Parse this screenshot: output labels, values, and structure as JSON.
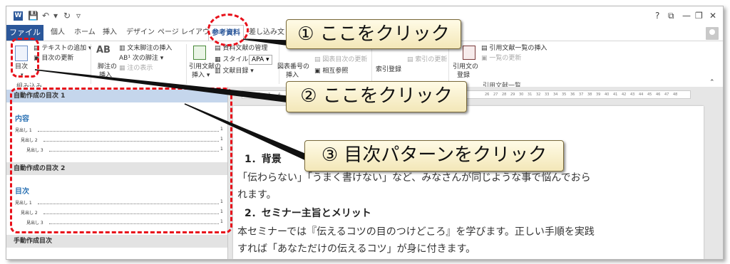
{
  "titlebar": {
    "app_icon": "W",
    "save_icon": "save-icon",
    "undo_icon": "undo-icon",
    "redo_icon": "redo-icon",
    "help": "?",
    "window_icons": [
      "restore-ribbon-icon",
      "minimize-icon",
      "maximize-icon",
      "close-icon"
    ]
  },
  "tabs": {
    "file": "ファイル",
    "items": [
      "個人",
      "ホーム",
      "挿入",
      "デザイン",
      "ページ レイアウト",
      "参考資料",
      "差し込み文"
    ]
  },
  "ribbon": {
    "toc": {
      "label": "目次",
      "add_text": "テキストの追加",
      "update": "目次の更新"
    },
    "footnote": {
      "label": "脚注の\n挿入",
      "endnote": "文末脚注の挿入",
      "next": "次の脚注",
      "show": "注の表示",
      "ab": "AB"
    },
    "citation": {
      "label": "引用文献の\n挿入",
      "manage": "資料文献の管理",
      "style_label": "スタイル:",
      "style_value": "APA",
      "bibliography": "文献目録"
    },
    "caption": {
      "label": "図表番号の\n挿入",
      "update_table": "図表目次の更新",
      "cross_ref": "相互参照"
    },
    "index": {
      "label": "索引登録",
      "update": "索引の更新"
    },
    "authorities": {
      "label": "引用文の\n登録",
      "insert": "引用文献一覧の挿入",
      "update": "一覧の更新",
      "group": "引用文献一覧"
    },
    "group_toc": "組み込み"
  },
  "gallery": {
    "auto1": {
      "heading": "自動作成の目次 1",
      "title": "内容"
    },
    "auto2": {
      "heading": "自動作成の目次 2",
      "title": "目次"
    },
    "manual": {
      "heading": "手動作成目次"
    },
    "entries": [
      "見出し 1",
      "見出し 2",
      "見出し 3"
    ],
    "page": "1"
  },
  "ruler": {
    "numbers": [
      "1",
      "2",
      "3",
      "4",
      "26",
      "27",
      "28",
      "29",
      "30",
      "31",
      "32",
      "33",
      "34",
      "35",
      "36",
      "37",
      "38",
      "39",
      "40",
      "41",
      "42",
      "43",
      "44",
      "45",
      "46",
      "47",
      "48"
    ]
  },
  "document": {
    "h1": "1．背景",
    "p1a": "「伝わらない」「うまく書けない」など、みなさんが同じような事で悩んでおら",
    "p1b": "れます。",
    "h2": "2．セミナー主旨とメリット",
    "p2a": "本セミナーでは『伝えるコツの目のつけどころ』を学びます。正しい手順を実践",
    "p2b": "すれば「あなただけの伝えるコツ」が身に付きます。"
  },
  "callouts": {
    "c1": "① ここをクリック",
    "c2": "② ここをクリック",
    "c3": "③ 目次パターンをクリック"
  },
  "colors": {
    "accent": "#2b579a",
    "annotation_red": "#e8101a",
    "callout_fill": "#fff6d5"
  }
}
